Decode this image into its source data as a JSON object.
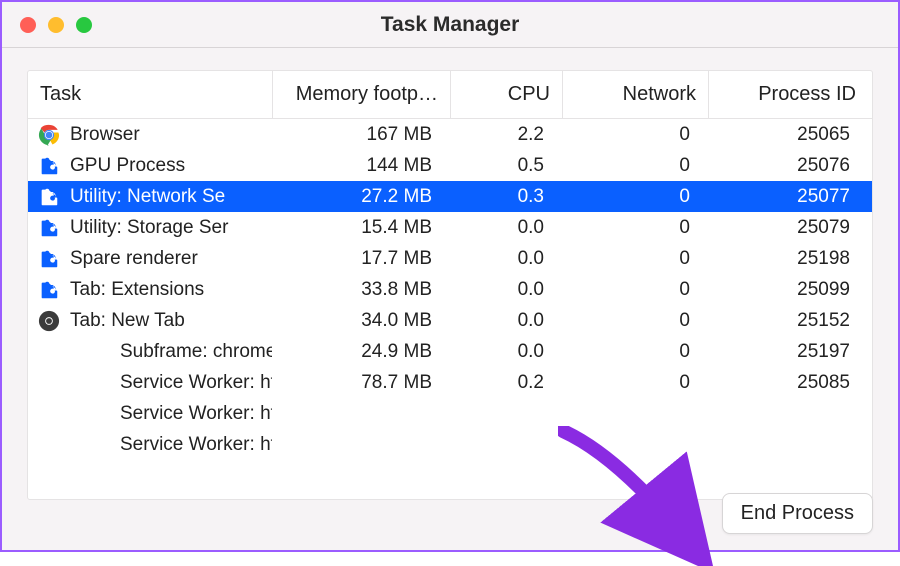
{
  "window": {
    "title": "Task Manager"
  },
  "columns": {
    "task": "Task",
    "mem": "Memory footp…",
    "cpu": "CPU",
    "net": "Network",
    "pid": "Process ID"
  },
  "button": {
    "end_process": "End Process"
  },
  "rows": [
    {
      "icon": "chrome",
      "name": "Browser",
      "mem": "167 MB",
      "cpu": "2.2",
      "net": "0",
      "pid": "25065",
      "selected": false
    },
    {
      "icon": "puzzle",
      "name": "GPU Process",
      "mem": "144 MB",
      "cpu": "0.5",
      "net": "0",
      "pid": "25076",
      "selected": false
    },
    {
      "icon": "puzzle",
      "name": "Utility: Network Se",
      "mem": "27.2 MB",
      "cpu": "0.3",
      "net": "0",
      "pid": "25077",
      "selected": true
    },
    {
      "icon": "puzzle",
      "name": "Utility: Storage Ser",
      "mem": "15.4 MB",
      "cpu": "0.0",
      "net": "0",
      "pid": "25079",
      "selected": false
    },
    {
      "icon": "puzzle",
      "name": "Spare renderer",
      "mem": "17.7 MB",
      "cpu": "0.0",
      "net": "0",
      "pid": "25198",
      "selected": false
    },
    {
      "icon": "puzzle",
      "name": "Tab: Extensions",
      "mem": "33.8 MB",
      "cpu": "0.0",
      "net": "0",
      "pid": "25099",
      "selected": false
    },
    {
      "icon": "chrome-gray",
      "name": "Tab: New Tab",
      "mem": "34.0 MB",
      "cpu": "0.0",
      "net": "0",
      "pid": "25152",
      "selected": false
    },
    {
      "icon": "none",
      "name": "Subframe: chrome-",
      "mem": "24.9 MB",
      "cpu": "0.0",
      "net": "0",
      "pid": "25197",
      "selected": false
    },
    {
      "icon": "none",
      "name": "Service Worker: htt",
      "mem": "78.7 MB",
      "cpu": "0.2",
      "net": "0",
      "pid": "25085",
      "selected": false
    },
    {
      "icon": "none",
      "name": "Service Worker: htt",
      "mem": "",
      "cpu": "",
      "net": "",
      "pid": "",
      "selected": false
    },
    {
      "icon": "none",
      "name": "Service Worker: htt",
      "mem": "",
      "cpu": "",
      "net": "",
      "pid": "",
      "selected": false
    }
  ],
  "annotation": {
    "arrow_color": "#8a2be2"
  }
}
